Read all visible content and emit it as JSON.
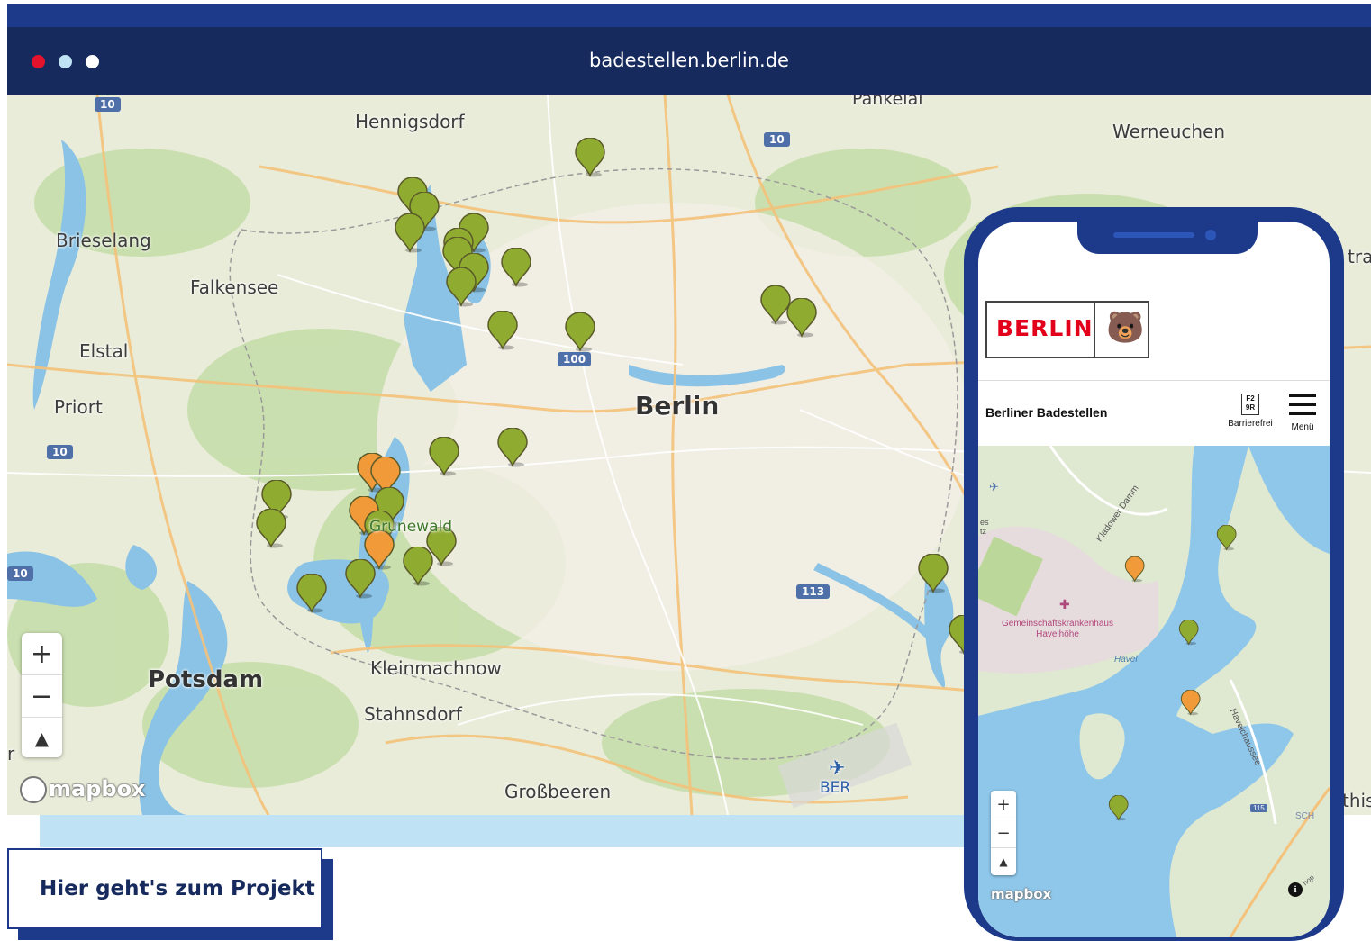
{
  "browser": {
    "url": "badestellen.berlin.de",
    "dot_colors": [
      "#e4132d",
      "#bfe3f4",
      "#ffffff"
    ]
  },
  "map": {
    "places": [
      "Pankelal",
      "Hennigsdorf",
      "Werneuchen",
      "Brieselang",
      "Falkensee",
      "Elstal",
      "Priort",
      "Berlin",
      "Grunewald",
      "Potsdam",
      "Kleinmachnow",
      "Stahnsdorf",
      "Großbeeren",
      "BER"
    ],
    "road_shields": [
      "10",
      "10",
      "100",
      "10",
      "10",
      "113"
    ],
    "edge_fragments": [
      "tra",
      "this",
      "r"
    ],
    "attribution": "mapbox",
    "zoom_in": "+",
    "zoom_out": "−",
    "compass": "▲",
    "marker_colors": {
      "good": "#8fac30",
      "warning": "#f09a3a"
    },
    "markers": {
      "good_count": 30,
      "warning_count": 5
    }
  },
  "cta": {
    "label": "Hier geht's zum Projekt"
  },
  "phone": {
    "logo_word": "BERLIN",
    "logo_bear": "🐻",
    "header_title": "Berliner Badestellen",
    "accessibility_label": "Barrierefrei",
    "accessibility_glyph": "F2 9R",
    "menu_label": "Menü",
    "map_labels": {
      "road1": "Kladower Damm",
      "hospital": "Gemeinschaftskrankenhaus Havelhöhe",
      "water": "Havel",
      "road2": "Havelchaussee",
      "shield": "115",
      "edge_left": "es tz",
      "edge_right": "SCH",
      "edge_top_right": "hop"
    },
    "zoom_in": "+",
    "zoom_out": "−",
    "compass": "▲",
    "attribution": "mapbox",
    "info": "i"
  }
}
